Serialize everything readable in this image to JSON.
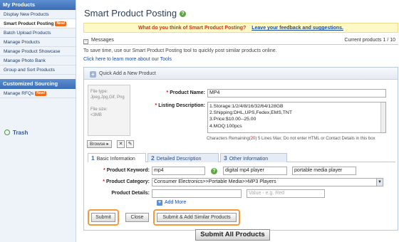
{
  "sidebar": {
    "section1": "My Products",
    "items": [
      {
        "label": "Display New Products",
        "badge": ""
      },
      {
        "label": "Smart Product Posting",
        "badge": "New!"
      },
      {
        "label": "Batch Upload Products",
        "badge": ""
      },
      {
        "label": "Manage Products",
        "badge": ""
      },
      {
        "label": "Manage Product Showcase",
        "badge": ""
      },
      {
        "label": "Manage Photo Bank",
        "badge": ""
      },
      {
        "label": "Group and Sort Products",
        "badge": ""
      }
    ],
    "section2": "Customized Sourcing",
    "items2": [
      {
        "label": "Manage RFQs",
        "badge": "New!"
      }
    ],
    "trash": "Trash"
  },
  "header": {
    "title": "Smart Product Posting",
    "help": "?"
  },
  "feedback": {
    "question": "What do you think of Smart Product Posting?",
    "link": "Leave your feedback and suggestions."
  },
  "messages": {
    "toggle": "−",
    "label": "Messages",
    "current": "Current products 1 / 10"
  },
  "intro": "To save time, use our Smart Product Posting tool to quickly post similar products online.",
  "learn_link": "Click here to learn more about our Tools",
  "panel": {
    "title": "Quick Add a New Product",
    "image": {
      "filetype_label": "File type:",
      "filetype_value": "Jpeg,Jpg,Gif, Png",
      "filesize_label": "File size:",
      "filesize_value": "<3MB"
    },
    "browse": "Browse",
    "product_name": {
      "label": "Product Name:",
      "value": "MP4"
    },
    "listing": {
      "label": "Listing Description:",
      "lines": [
        "1.Storage:1/2/4/8/16/32/64/128GB",
        "2.Shipping:DHL,UPS,Fedex,EMS,TNT",
        "3.Price:$10.00--25.00",
        "4.MOQ:100pcs"
      ],
      "note_prefix": "Characters Remaining(",
      "note_count": "20",
      "note_suffix": ") 5 Lines Max; Do not enter HTML or Contact Details in this box"
    },
    "tabs": [
      {
        "num": "1",
        "label": "Basic Information"
      },
      {
        "num": "2",
        "label": "Detailed Description"
      },
      {
        "num": "3",
        "label": "Other Information"
      }
    ],
    "keyword": {
      "label": "Product Keyword:",
      "values": [
        "mp4",
        "digital mp4 player",
        "portable media player"
      ]
    },
    "category": {
      "label": "Product Category:",
      "value": "Consumer Electronics>>Portable Media>>MP3 Players"
    },
    "details": {
      "label": "Product Details:",
      "name_value": "",
      "value_placeholder": "Value - e.g. Red"
    },
    "add_more": "Add More",
    "buttons": {
      "submit": "Submit",
      "close": "Close",
      "submit_similar": "Submit & Add Similar Products"
    }
  },
  "submit_all": "Submit All Products",
  "colors": {
    "accent": "#f39b3b",
    "link": "#1b4ea3",
    "sidebar_head": "#3b6db6"
  }
}
